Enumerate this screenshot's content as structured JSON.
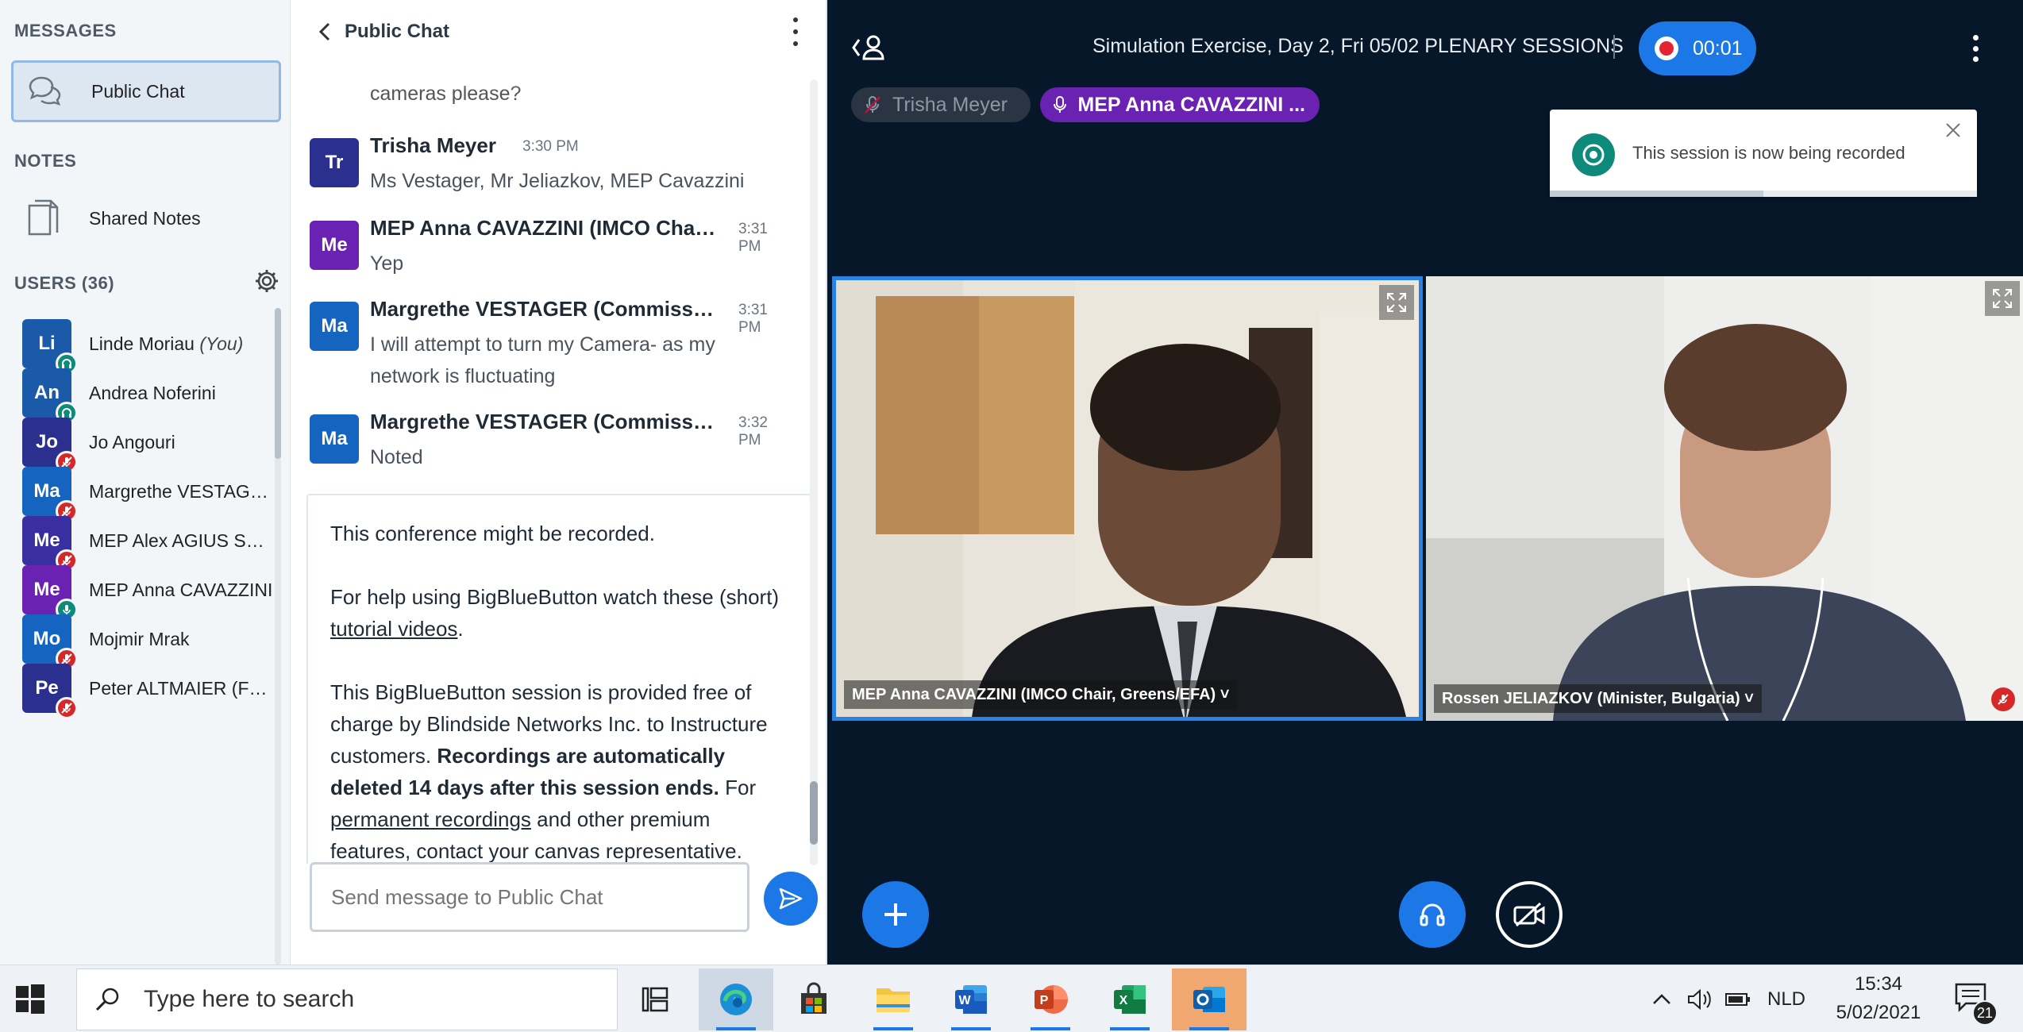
{
  "sidebar": {
    "messages_title": "MESSAGES",
    "public_chat_label": "Public Chat",
    "notes_title": "NOTES",
    "shared_notes_label": "Shared Notes",
    "users_title": "USERS (36)",
    "users": [
      {
        "initials": "Li",
        "name": "Linde Moriau",
        "suffix": "(You)",
        "color": "#1a5aa8",
        "badge": "headset"
      },
      {
        "initials": "An",
        "name": "Andrea Noferini",
        "suffix": "",
        "color": "#1a5aa8",
        "badge": "headset"
      },
      {
        "initials": "Jo",
        "name": "Jo Angouri",
        "suffix": "",
        "color": "#2b2f8e",
        "badge": "mic-muted"
      },
      {
        "initials": "Ma",
        "name": "Margrethe VESTAGER (Commission...",
        "suffix": "",
        "color": "#1565c0",
        "badge": "mic-muted"
      },
      {
        "initials": "Me",
        "name": "MEP Alex AGIUS SALIBA",
        "suffix": "",
        "color": "#3a2fa0",
        "badge": "mic-muted"
      },
      {
        "initials": "Me",
        "name": "MEP Anna CAVAZZINI",
        "suffix": "",
        "color": "#6a22b2",
        "badge": "mic"
      },
      {
        "initials": "Mo",
        "name": "Mojmir Mrak",
        "suffix": "",
        "color": "#1565c0",
        "badge": "mic-muted"
      },
      {
        "initials": "Pe",
        "name": "Peter ALTMAIER (Federal Minister)",
        "suffix": "",
        "color": "#2b2f8e",
        "badge": "mic-muted"
      }
    ]
  },
  "chat": {
    "title": "Public Chat",
    "cut_message": "cameras please?",
    "messages": [
      {
        "initials": "Tr",
        "color": "#2b2f8e",
        "name": "Trisha Meyer",
        "time": "3:30 PM",
        "lines": [
          "Ms Vestager, Mr Jeliazkov, MEP Cavazzini"
        ]
      },
      {
        "initials": "Me",
        "color": "#6a22b2",
        "name": "MEP Anna CAVAZZINI (IMCO Chair, Greens/EFA)",
        "time": "3:31 PM",
        "lines": [
          "Yep"
        ]
      },
      {
        "initials": "Ma",
        "color": "#1565c0",
        "name": "Margrethe VESTAGER (Commission...",
        "time": "3:31 PM",
        "lines": [
          "I will attempt to turn my Camera- as my",
          "network is fluctuating"
        ]
      },
      {
        "initials": "Ma",
        "color": "#1565c0",
        "name": "Margrethe VESTAGER (Commission...",
        "time": "3:32 PM",
        "lines": [
          "Noted"
        ]
      }
    ],
    "welcome": {
      "p1": "This conference might be recorded.",
      "p2_pre": "For help using BigBlueButton watch these (short) ",
      "p2_link": "tutorial videos",
      "p2_post": ".",
      "p3_a": "This BigBlueButton session is provided free of charge by Blindside Networks Inc. to Instructure customers. ",
      "p3_bold": "Recordings are automatically deleted 14 days after this session ends.",
      "p3_b": " For ",
      "p3_link": "permanent recordings",
      "p3_c": " and other premium features, contact your canvas representative."
    },
    "input_placeholder": "Send message to Public Chat"
  },
  "stage": {
    "meeting_title": "Simulation Exercise, Day 2, Fri 05/02 PLENARY SESSIONS",
    "record_time": "00:01",
    "talkers": [
      {
        "name": "Trisha Meyer",
        "state": "muted"
      },
      {
        "name": "MEP Anna CAVAZZINI ...",
        "state": "talking"
      }
    ],
    "toast_text": "This session is now being recorded",
    "toast_progress": 0.5,
    "videos": [
      {
        "name": "MEP Anna CAVAZZINI (IMCO Chair, Greens/EFA) ˅"
      },
      {
        "name": "Rossen JELIAZKOV (Minister, Bulgaria) ˅"
      }
    ]
  },
  "taskbar": {
    "search_placeholder": "Type here to search",
    "language": "NLD",
    "time": "15:34",
    "date": "5/02/2021",
    "notification_count": "21"
  }
}
